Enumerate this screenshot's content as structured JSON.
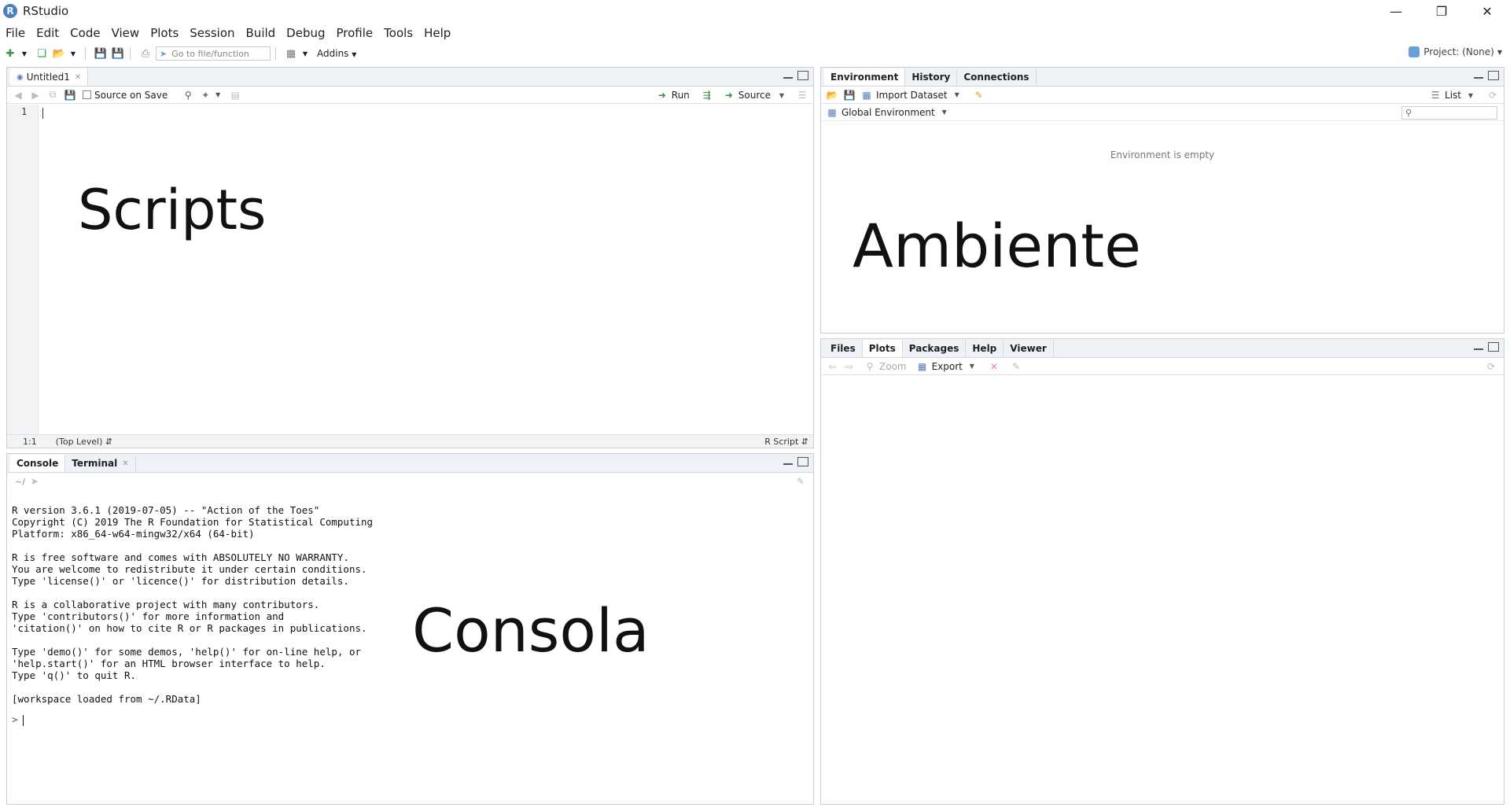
{
  "window": {
    "title": "RStudio",
    "logo_letter": "R"
  },
  "menu": [
    "File",
    "Edit",
    "Code",
    "View",
    "Plots",
    "Session",
    "Build",
    "Debug",
    "Profile",
    "Tools",
    "Help"
  ],
  "toolbar": {
    "goto_placeholder": "Go to file/function",
    "addins_label": "Addins",
    "project_label": "Project: (None)"
  },
  "source_pane": {
    "tab_label": "Untitled1",
    "source_on_save_label": "Source on Save",
    "run_label": "Run",
    "source_label": "Source",
    "line_number": "1",
    "status_position": "1:1",
    "status_scope": "(Top Level)",
    "status_filetype": "R Script",
    "overlay_label": "Scripts"
  },
  "console_pane": {
    "tabs": [
      "Console",
      "Terminal"
    ],
    "path": "~/",
    "lines": [
      "R version 3.6.1 (2019-07-05) -- \"Action of the Toes\"",
      "Copyright (C) 2019 The R Foundation for Statistical Computing",
      "Platform: x86_64-w64-mingw32/x64 (64-bit)",
      "",
      "R is free software and comes with ABSOLUTELY NO WARRANTY.",
      "You are welcome to redistribute it under certain conditions.",
      "Type 'license()' or 'licence()' for distribution details.",
      "",
      "R is a collaborative project with many contributors.",
      "Type 'contributors()' for more information and",
      "'citation()' on how to cite R or R packages in publications.",
      "",
      "Type 'demo()' for some demos, 'help()' for on-line help, or",
      "'help.start()' for an HTML browser interface to help.",
      "Type 'q()' to quit R.",
      "",
      "[workspace loaded from ~/.RData]"
    ],
    "prompt": ">",
    "overlay_label": "Consola"
  },
  "env_pane": {
    "tabs": [
      "Environment",
      "History",
      "Connections"
    ],
    "import_label": "Import Dataset",
    "list_label": "List",
    "scope_label": "Global Environment",
    "empty_message": "Environment is empty",
    "overlay_label": "Ambiente"
  },
  "files_pane": {
    "tabs": [
      "Files",
      "Plots",
      "Packages",
      "Help",
      "Viewer"
    ],
    "zoom_label": "Zoom",
    "export_label": "Export"
  },
  "colors": {
    "pane_border": "#c8cfd8",
    "tab_bg": "#eef1f5",
    "accent": "#4a7fc1"
  }
}
